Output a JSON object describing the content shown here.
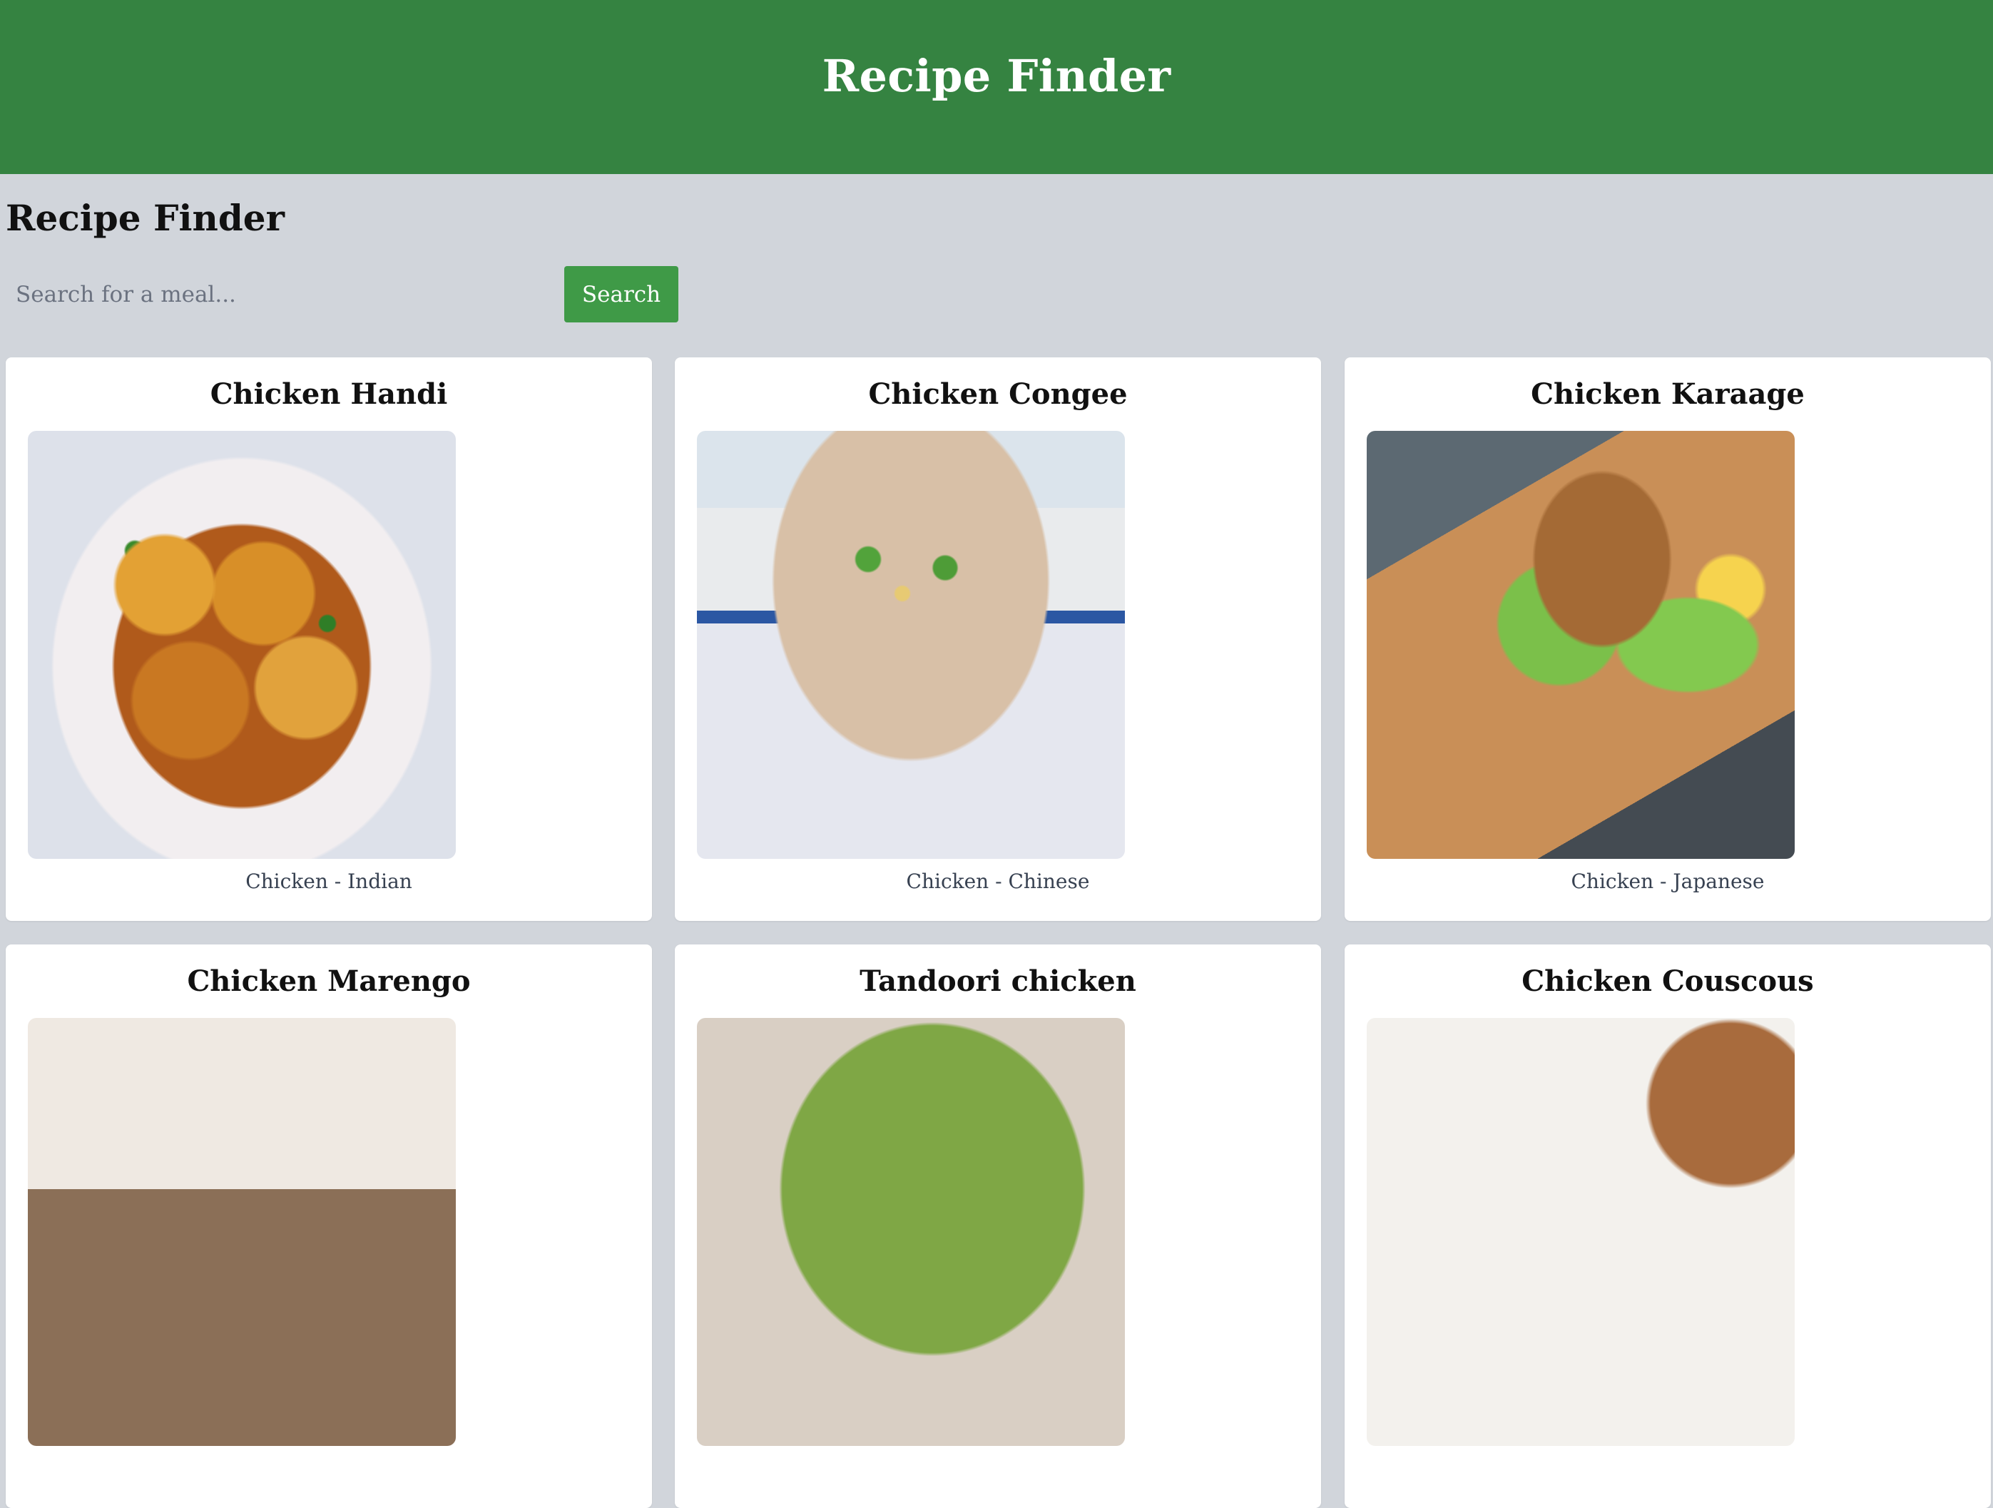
{
  "header": {
    "title": "Recipe Finder"
  },
  "page": {
    "title": "Recipe Finder"
  },
  "search": {
    "placeholder": "Search for a meal...",
    "button_label": "Search"
  },
  "recipes": [
    {
      "title": "Chicken Handi",
      "meta": "Chicken - Indian"
    },
    {
      "title": "Chicken Congee",
      "meta": "Chicken - Chinese"
    },
    {
      "title": "Chicken Karaage",
      "meta": "Chicken - Japanese"
    },
    {
      "title": "Chicken Marengo",
      "meta": ""
    },
    {
      "title": "Tandoori chicken",
      "meta": ""
    },
    {
      "title": "Chicken Couscous",
      "meta": ""
    }
  ],
  "colors": {
    "header_bg": "#358341",
    "button_bg": "#3f9a47",
    "page_bg": "#d1d5db"
  }
}
